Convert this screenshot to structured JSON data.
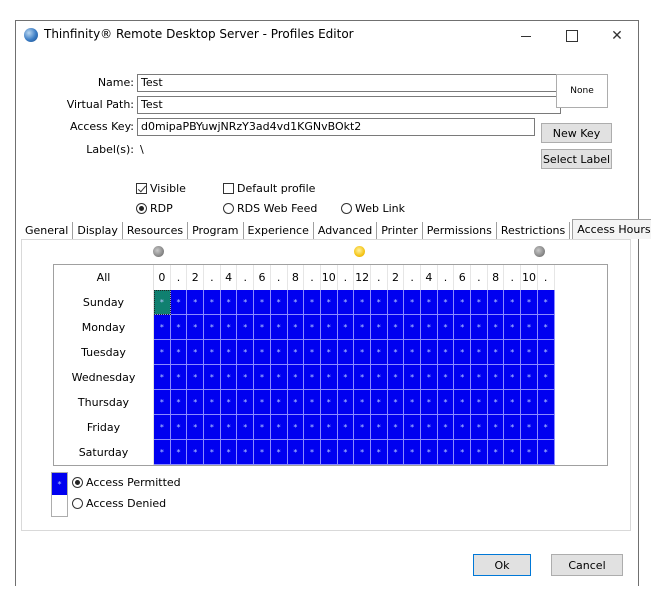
{
  "window": {
    "title": "Thinfinity® Remote Desktop Server - Profiles Editor",
    "controls": {
      "minimize": "minimize",
      "maximize": "maximize",
      "close": "✕"
    }
  },
  "form": {
    "name_label": "Name:",
    "name_value": "Test",
    "virtual_path_label": "Virtual Path:",
    "virtual_path_value": "Test",
    "access_key_label": "Access Key:",
    "access_key_value": "d0mipaPBYuwjNRzY3ad4vd1KGNvBOkt2",
    "labels_label": "Label(s):",
    "labels_value": "\\",
    "icon_box_label": "None",
    "new_key_button": "New Key",
    "select_label_button": "Select Label"
  },
  "options": {
    "visible": {
      "label": "Visible",
      "checked": true
    },
    "default_profile": {
      "label": "Default profile",
      "checked": false
    },
    "profile_type": {
      "selected": "RDP",
      "choices": [
        "RDP",
        "RDS Web Feed",
        "Web Link"
      ]
    }
  },
  "tabs": [
    {
      "label": "General",
      "active": false
    },
    {
      "label": "Display",
      "active": false
    },
    {
      "label": "Resources",
      "active": false
    },
    {
      "label": "Program",
      "active": false
    },
    {
      "label": "Experience",
      "active": false
    },
    {
      "label": "Advanced",
      "active": false
    },
    {
      "label": "Printer",
      "active": false
    },
    {
      "label": "Permissions",
      "active": false
    },
    {
      "label": "Restrictions",
      "active": false
    },
    {
      "label": "Access Hours",
      "active": true
    }
  ],
  "access_hours": {
    "time_icons": [
      "moon-icon",
      "sun-icon",
      "moon-icon"
    ],
    "all_label": "All",
    "hour_headers": [
      "0",
      ".",
      "2",
      ".",
      "4",
      ".",
      "6",
      ".",
      "8",
      ".",
      "10",
      ".",
      "12",
      ".",
      "2",
      ".",
      "4",
      ".",
      "6",
      ".",
      "8",
      ".",
      "10",
      "."
    ],
    "days": [
      "Sunday",
      "Monday",
      "Tuesday",
      "Wednesday",
      "Thursday",
      "Friday",
      "Saturday"
    ],
    "cell_mark": "*",
    "all_permitted": true,
    "selected_cell": {
      "day": "Sunday",
      "hour": 0
    },
    "permitted_color": "#0000f0"
  },
  "legend": {
    "mark": "*",
    "selected": "Access Permitted",
    "choices": [
      "Access Permitted",
      "Access Denied"
    ]
  },
  "footer": {
    "ok_button": "Ok",
    "cancel_button": "Cancel"
  }
}
